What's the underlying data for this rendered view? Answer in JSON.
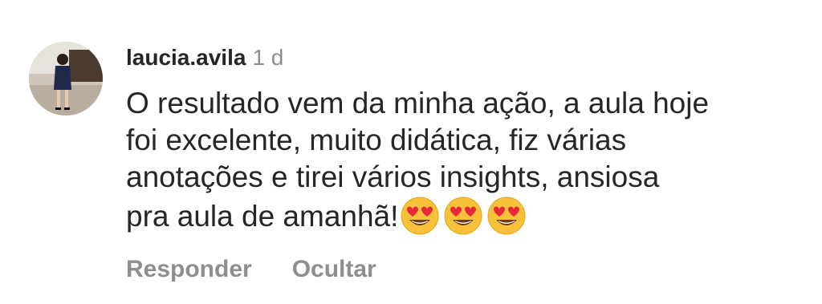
{
  "comment": {
    "username": "laucia.avila",
    "timestamp": "1 d",
    "text_lines": [
      "O resultado vem da minha ação, a aula hoje",
      "foi excelente, muito didática,  fiz várias",
      "anotações e tirei vários insights, ansiosa",
      "pra aula de amanhã!"
    ],
    "emojis": [
      "smiling-face-with-heart-eyes",
      "smiling-face-with-heart-eyes",
      "smiling-face-with-heart-eyes"
    ],
    "actions": {
      "reply_label": "Responder",
      "hide_label": "Ocultar"
    }
  },
  "colors": {
    "text": "#262626",
    "secondary": "#8e8e8e",
    "emoji_face": "#f7c23a",
    "emoji_heart": "#e8283a"
  }
}
